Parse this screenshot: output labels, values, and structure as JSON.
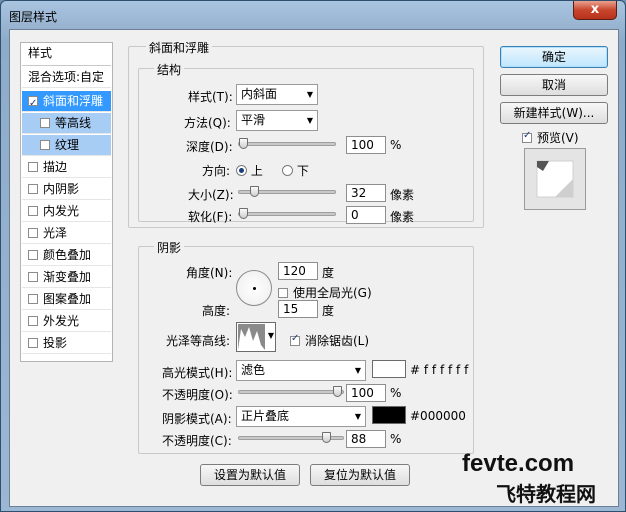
{
  "window": {
    "title": "图层样式",
    "close_glyph": "x"
  },
  "sidebar": {
    "header": "样式",
    "blend_options": "混合选项:自定",
    "items": [
      {
        "label": "斜面和浮雕",
        "checked": true
      },
      {
        "label": "等高线",
        "checked": false
      },
      {
        "label": "纹理",
        "checked": false
      },
      {
        "label": "描边",
        "checked": false
      },
      {
        "label": "内阴影",
        "checked": false
      },
      {
        "label": "内发光",
        "checked": false
      },
      {
        "label": "光泽",
        "checked": false
      },
      {
        "label": "颜色叠加",
        "checked": false
      },
      {
        "label": "渐变叠加",
        "checked": false
      },
      {
        "label": "图案叠加",
        "checked": false
      },
      {
        "label": "外发光",
        "checked": false
      },
      {
        "label": "投影",
        "checked": false
      }
    ]
  },
  "bevel": {
    "group_title": "斜面和浮雕",
    "structure_title": "结构",
    "style_label": "样式(T):",
    "style_value": "内斜面",
    "technique_label": "方法(Q):",
    "technique_value": "平滑",
    "depth_label": "深度(D):",
    "depth_value": "100",
    "depth_unit": "%",
    "depth_fraction": 0.0,
    "direction_label": "方向:",
    "dir_up": "上",
    "dir_down": "下",
    "size_label": "大小(Z):",
    "size_value": "32",
    "size_unit": "像素",
    "size_fraction": 0.13,
    "soften_label": "软化(F):",
    "soften_value": "0",
    "soften_unit": "像素",
    "soften_fraction": 0.0
  },
  "shading": {
    "title": "阴影",
    "angle_label": "角度(N):",
    "angle_value": "120",
    "angle_unit": "度",
    "global_light_label": "使用全局光(G)",
    "global_light": false,
    "altitude_label": "高度:",
    "altitude_value": "15",
    "altitude_unit": "度",
    "gloss_label": "光泽等高线:",
    "antialias_label": "消除锯齿(L)",
    "antialias": true,
    "highlight_label": "高光模式(H):",
    "highlight_value": "滤色",
    "highlight_color": "#ffffff",
    "highlight_hex": "# f f f f f f",
    "highlight_opacity_label": "不透明度(O):",
    "highlight_opacity": "100",
    "highlight_opacity_unit": "%",
    "highlight_opacity_fraction": 1.0,
    "shadow_label": "阴影模式(A):",
    "shadow_value": "正片叠底",
    "shadow_color": "#000000",
    "shadow_hex": "#000000",
    "shadow_opacity_label": "不透明度(C):",
    "shadow_opacity": "88",
    "shadow_opacity_unit": "%",
    "shadow_opacity_fraction": 0.88
  },
  "footer": {
    "make_default": "设置为默认值",
    "reset_default": "复位为默认值"
  },
  "actions": {
    "ok": "确定",
    "cancel": "取消",
    "new_style": "新建样式(W)...",
    "preview_label": "预览(V)",
    "preview": true
  },
  "watermark": {
    "line1": "fevte.com",
    "line2": "飞特教程网"
  }
}
